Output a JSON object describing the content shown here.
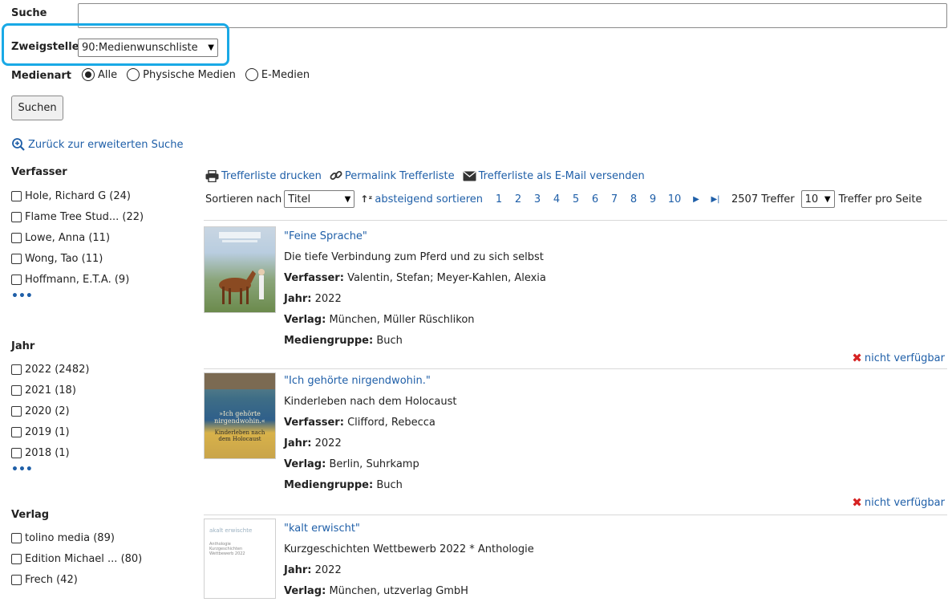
{
  "search": {
    "label": "Suche",
    "value": "",
    "placeholder": ""
  },
  "branch": {
    "label": "Zweigstelle",
    "selected": "90:Medienwunschliste"
  },
  "media_type": {
    "label": "Medienart",
    "options": [
      "Alle",
      "Physische Medien",
      "E-Medien"
    ],
    "selected": "Alle"
  },
  "search_button": "Suchen",
  "back_link": "Zurück zur erweiterten Suche",
  "facets": {
    "author": {
      "title": "Verfasser",
      "items": [
        "Hole, Richard G (24)",
        "Flame Tree Stud... (22)",
        "Lowe, Anna (11)",
        "Wong, Tao (11)",
        "Hoffmann, E.T.A. (9)"
      ],
      "more": "•••"
    },
    "year": {
      "title": "Jahr",
      "items": [
        "2022 (2482)",
        "2021 (18)",
        "2020 (2)",
        "2019 (1)",
        "2018 (1)"
      ],
      "more": "•••"
    },
    "publisher": {
      "title": "Verlag",
      "items": [
        "tolino media (89)",
        "Edition Michael ... (80)",
        "Frech (42)"
      ]
    }
  },
  "toolbar": {
    "print": "Trefferliste drucken",
    "permalink": "Permalink Trefferliste",
    "email": "Trefferliste als E-Mail versenden"
  },
  "sort": {
    "label": "Sortieren nach",
    "selected": "Titel",
    "direction": "absteigend sortieren"
  },
  "pager": {
    "pages": [
      "1",
      "2",
      "3",
      "4",
      "5",
      "6",
      "7",
      "8",
      "9",
      "10"
    ],
    "total": "2507 Treffer",
    "per_page": "10",
    "per_page_label": "Treffer pro Seite"
  },
  "labels": {
    "author": "Verfasser:",
    "year": "Jahr:",
    "publisher": "Verlag:",
    "media_group": "Mediengruppe:"
  },
  "results": [
    {
      "title": "\"Feine Sprache\"",
      "subtitle": "Die tiefe Verbindung zum Pferd und zu sich selbst",
      "author": "Valentin, Stefan; Meyer-Kahlen, Alexia",
      "year": "2022",
      "publisher": "München, Müller Rüschlikon",
      "media_group": "Buch",
      "availability": "nicht verfügbar"
    },
    {
      "title": "\"Ich gehörte nirgendwohin.\"",
      "subtitle": "Kinderleben nach dem Holocaust",
      "author": "Clifford, Rebecca",
      "year": "2022",
      "publisher": "Berlin, Suhrkamp",
      "media_group": "Buch",
      "availability": "nicht verfügbar",
      "cover_text": [
        "»Ich gehörte",
        "nirgendwohin.«",
        "Kinderleben nach",
        "dem Holocaust"
      ]
    },
    {
      "title": "\"kalt erwischt\"",
      "subtitle": "Kurzgeschichten Wettbewerb 2022 * Anthologie",
      "year": "2022",
      "publisher": "München, utzverlag GmbH",
      "cover_text": [
        "akalt erwischte",
        "Anthologie",
        "Kurzgeschichten",
        "Wettbewerb 2022"
      ]
    }
  ],
  "colors": {
    "link": "#1f5fa8",
    "highlight": "#19a9e6",
    "unavailable": "#d62222"
  }
}
